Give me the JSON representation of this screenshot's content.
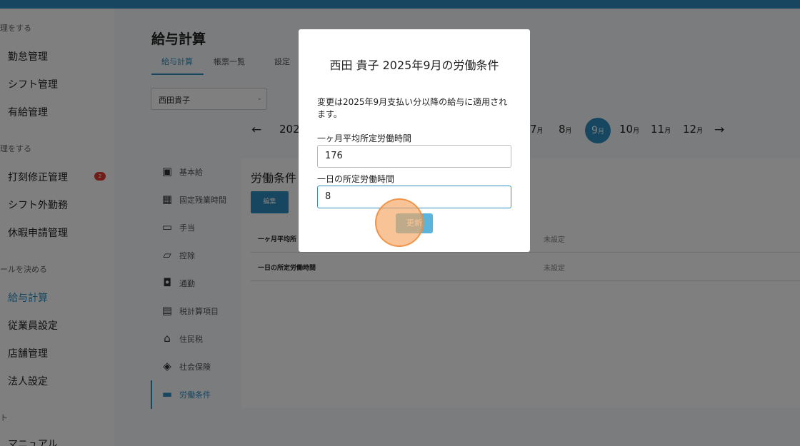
{
  "sidebar": {
    "sections": [
      {
        "label": "理をする",
        "items": [
          "勤怠管理",
          "シフト管理",
          "有給管理"
        ]
      },
      {
        "label": "理をする",
        "items": [
          "打刻修正管理",
          "シフト外勤務",
          "休暇申請管理"
        ]
      },
      {
        "label": "ールを決める",
        "items": [
          "給与計算",
          "従業員設定",
          "店舗管理",
          "法人設定"
        ]
      },
      {
        "label": "ト",
        "items": [
          "マニュアル"
        ]
      }
    ],
    "badge_count": "2",
    "active_item": "給与計算"
  },
  "page": {
    "title": "給与計算",
    "tabs": [
      "給与計算",
      "帳票一覧",
      "設定"
    ],
    "employee_select": "西田貴子"
  },
  "month_nav": {
    "prev_arrow": "←",
    "next_arrow": "→",
    "year_partial": "202",
    "months": [
      {
        "num": "7",
        "unit": "月"
      },
      {
        "num": "8",
        "unit": "月"
      },
      {
        "num": "9",
        "unit": "月"
      },
      {
        "num": "10",
        "unit": "月"
      },
      {
        "num": "11",
        "unit": "月"
      },
      {
        "num": "12",
        "unit": "月"
      }
    ],
    "selected": "9"
  },
  "left_nav": [
    {
      "label": "基本給",
      "icon": "money-icon"
    },
    {
      "label": "固定残業時間",
      "icon": "building-icon"
    },
    {
      "label": "手当",
      "icon": "wallet-add-icon"
    },
    {
      "label": "控除",
      "icon": "folder-minus-icon"
    },
    {
      "label": "通勤",
      "icon": "train-icon"
    },
    {
      "label": "税計算項目",
      "icon": "calculator-icon"
    },
    {
      "label": "住民税",
      "icon": "home-icon"
    },
    {
      "label": "社会保険",
      "icon": "shield-icon"
    },
    {
      "label": "労働条件",
      "icon": "briefcase-icon"
    }
  ],
  "panel": {
    "title": "労働条件",
    "edit_label": "編集",
    "rows": [
      {
        "label": "一ヶ月平均所",
        "value": "未設定"
      },
      {
        "label": "一日の所定労働時間",
        "value": "未設定"
      }
    ]
  },
  "modal": {
    "title": "西田 貴子 2025年9月の労働条件",
    "note": "変更は2025年9月支払い分以降の給与に適用されます。",
    "field1_label": "一ヶ月平均所定労働時間",
    "field1_value": "176",
    "field2_label": "一日の所定労働時間",
    "field2_value": "8",
    "update_label": "更新"
  },
  "colors": {
    "accent": "#2f8fc0",
    "badge": "#e53935",
    "click_indicator": "#f5a55f"
  }
}
